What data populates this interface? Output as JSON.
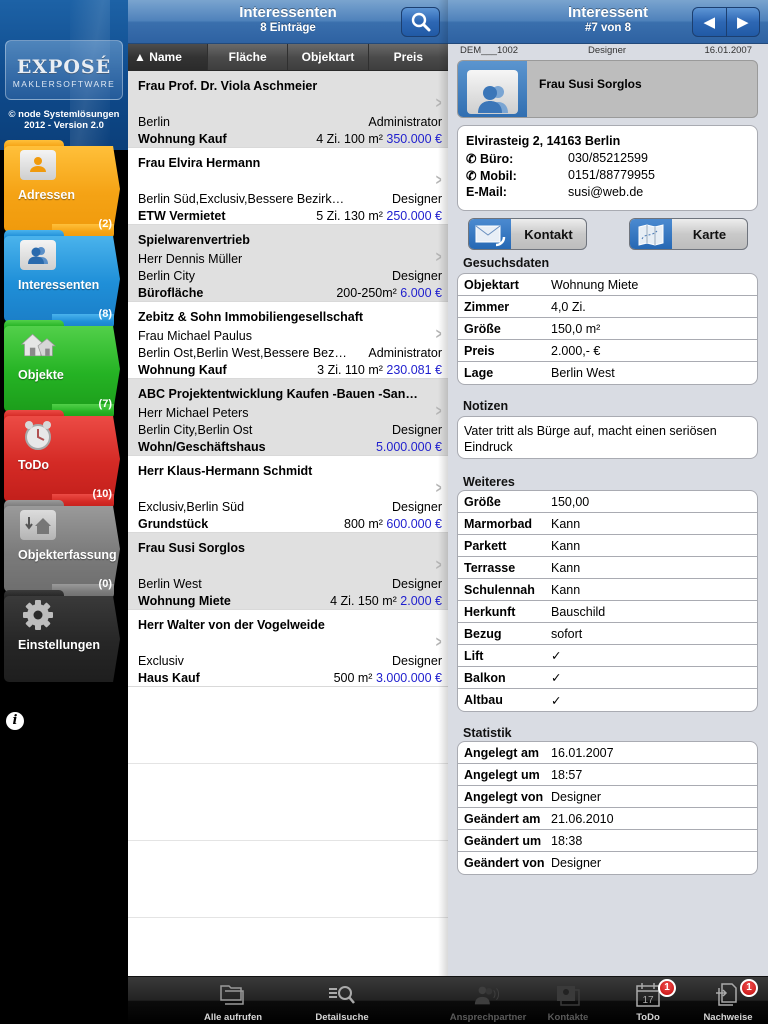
{
  "sidebar": {
    "logo": {
      "brand": "EXPOSÉ",
      "subtitle": "MAKLERSOFTWARE"
    },
    "copyright_line1": "© node Systemlösungen",
    "copyright_line2": "2012 - Version 2.0",
    "items": [
      {
        "label": "Adressen",
        "count": "(2)",
        "icon": "address-card-icon",
        "color": "#f5a315"
      },
      {
        "label": "Interessenten",
        "count": "(8)",
        "icon": "people-icon",
        "color": "#1f8fd8"
      },
      {
        "label": "Objekte",
        "count": "(7)",
        "icon": "houses-icon",
        "color": "#25b324"
      },
      {
        "label": "ToDo",
        "count": "(10)",
        "icon": "alarm-clock-icon",
        "color": "#d42a25"
      },
      {
        "label": "Objekterfassung",
        "count": "(0)",
        "icon": "house-import-icon",
        "color": "#7b7b7b"
      },
      {
        "label": "Einstellungen",
        "count": "",
        "icon": "gear-icon",
        "color": "#262626"
      }
    ],
    "info_glyph": "i"
  },
  "list": {
    "title": "Interessenten",
    "subtitle": "8 Einträge",
    "sort_columns": [
      "▲  Name",
      "Fläche",
      "Objektart",
      "Preis"
    ],
    "price_color": "#1f1fce",
    "rows": [
      {
        "title": "Frau Prof. Dr. Viola Aschmeier",
        "contact": "",
        "area": "Berlin",
        "user": "Administrator",
        "type": "Wohnung Kauf",
        "specs": "4 Zi. 100 m²",
        "price": "350.000 €"
      },
      {
        "title": "Frau Elvira Hermann",
        "contact": "",
        "area": "Berlin Süd,Exclusiv,Bessere Bezirk…",
        "user": "Designer",
        "type": "ETW Vermietet",
        "specs": "5 Zi. 130 m²",
        "price": "250.000 €"
      },
      {
        "title": "Spielwarenvertrieb",
        "contact": "Herr Dennis Müller",
        "area": "Berlin City",
        "user": "Designer",
        "type": "Bürofläche",
        "specs": "200-250m²",
        "price": "6.000 €"
      },
      {
        "title": "Zebitz & Sohn Immobiliengesellschaft",
        "contact": "Frau Michael Paulus",
        "area": "Berlin Ost,Berlin West,Bessere Bez…",
        "user": "Administrator",
        "type": "Wohnung Kauf",
        "specs": "3 Zi. 110 m²",
        "price": "230.081 €"
      },
      {
        "title": "ABC Projektentwicklung Kaufen -Bauen -San…",
        "contact": "Herr Michael Peters",
        "area": "Berlin City,Berlin Ost",
        "user": "Designer",
        "type": "Wohn/Geschäftshaus",
        "specs": "",
        "price": "5.000.000 €"
      },
      {
        "title": "Herr Klaus-Hermann Schmidt",
        "contact": "",
        "area": "Exclusiv,Berlin Süd",
        "user": "Designer",
        "type": "Grundstück",
        "specs": "800 m²",
        "price": "600.000 €"
      },
      {
        "title": "Frau Susi Sorglos",
        "contact": "",
        "area": "Berlin West",
        "user": "Designer",
        "type": "Wohnung Miete",
        "specs": "4 Zi. 150 m²",
        "price": "2.000 €"
      },
      {
        "title": "Herr Walter von der Vogelweide",
        "contact": "",
        "area": "Exclusiv",
        "user": "Designer",
        "type": "Haus Kauf",
        "specs": "500 m²",
        "price": "3.000.000 €"
      }
    ]
  },
  "detail": {
    "title": "Interessent",
    "subtitle": "#7 von 8",
    "prev_glyph": "◀",
    "next_glyph": "▶",
    "meta": {
      "id": "DEM___1002",
      "user": "Designer",
      "date": "16.01.2007"
    },
    "name": "Frau Susi Sorglos",
    "address": "Elvirasteig 2, 14163 Berlin",
    "contacts": [
      {
        "label": "Büro:",
        "value": "030/85212599",
        "phone": true
      },
      {
        "label": "Mobil:",
        "value": "0151/88779955",
        "phone": true
      },
      {
        "label": "E-Mail:",
        "value": "susi@web.de",
        "phone": false
      }
    ],
    "phone_glyph": "✆",
    "buttons": {
      "contact": "Kontakt",
      "map": "Karte"
    },
    "gesuch": {
      "heading": "Gesuchsdaten",
      "rows": [
        {
          "k": "Objektart",
          "v": "Wohnung Miete"
        },
        {
          "k": "Zimmer",
          "v": "4,0 Zi."
        },
        {
          "k": "Größe",
          "v": "150,0 m²"
        },
        {
          "k": "Preis",
          "v": "2.000,- €"
        },
        {
          "k": "Lage",
          "v": "Berlin West"
        }
      ]
    },
    "notizen": {
      "heading": "Notizen",
      "text": "Vater tritt als Bürge auf, macht einen seriösen Eindruck"
    },
    "weiteres": {
      "heading": "Weiteres",
      "rows": [
        {
          "k": "Größe",
          "v": "150,00"
        },
        {
          "k": "Marmorbad",
          "v": "Kann"
        },
        {
          "k": "Parkett",
          "v": "Kann"
        },
        {
          "k": "Terrasse",
          "v": "Kann"
        },
        {
          "k": "Schulennah",
          "v": "Kann"
        },
        {
          "k": "Herkunft",
          "v": "Bauschild"
        },
        {
          "k": "Bezug",
          "v": "sofort"
        },
        {
          "k": "Lift",
          "v": "✓"
        },
        {
          "k": "Balkon",
          "v": "✓"
        },
        {
          "k": "Altbau",
          "v": "✓"
        }
      ]
    },
    "statistik": {
      "heading": "Statistik",
      "rows": [
        {
          "k": "Angelegt am",
          "v": "16.01.2007"
        },
        {
          "k": "Angelegt um",
          "v": "18:57"
        },
        {
          "k": "Angelegt von",
          "v": "Designer"
        },
        {
          "k": "Geändert am",
          "v": "21.06.2010"
        },
        {
          "k": "Geändert um",
          "v": "18:38"
        },
        {
          "k": "Geändert von",
          "v": "Designer"
        }
      ]
    }
  },
  "tabbar": {
    "tabs": [
      {
        "label": "Alle aufrufen",
        "icon": "folders-icon",
        "enabled": true,
        "badge": ""
      },
      {
        "label": "Detailsuche",
        "icon": "list-search-icon",
        "enabled": true,
        "badge": ""
      },
      {
        "label": "Ansprechpartner",
        "icon": "contact-persons-icon",
        "enabled": false,
        "badge": ""
      },
      {
        "label": "Kontakte",
        "icon": "contacts-stack-icon",
        "enabled": false,
        "badge": ""
      },
      {
        "label": "ToDo",
        "icon": "calendar-icon",
        "enabled": true,
        "badge": "1",
        "calendar_day": "17"
      },
      {
        "label": "Nachweise",
        "icon": "documents-icon",
        "enabled": true,
        "badge": "1"
      }
    ]
  }
}
